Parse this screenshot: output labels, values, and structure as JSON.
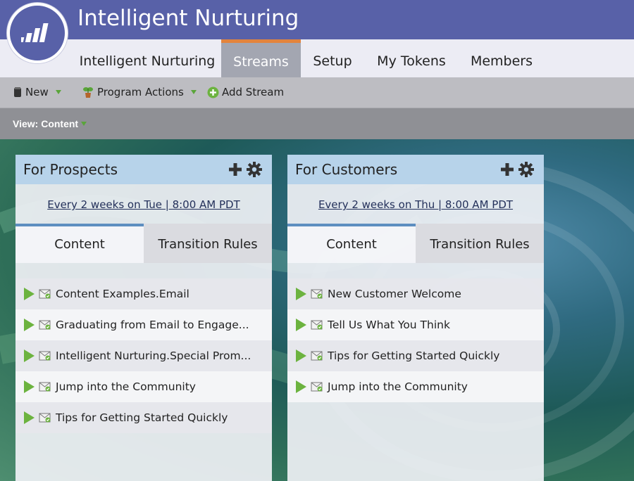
{
  "header": {
    "title": "Intelligent Nurturing"
  },
  "tabs": [
    {
      "label": "Intelligent Nurturing"
    },
    {
      "label": "Streams"
    },
    {
      "label": "Setup"
    },
    {
      "label": "My Tokens"
    },
    {
      "label": "Members"
    }
  ],
  "active_tab": "Streams",
  "toolbar": {
    "new_label": "New",
    "program_actions_label": "Program Actions",
    "add_stream_label": "Add Stream"
  },
  "view": {
    "label": "View: Content"
  },
  "colors": {
    "header": "#5861a8",
    "active_tab_accent": "#e3843d",
    "play": "#6cb33f",
    "card_header": "#b7d3ea"
  },
  "streams": [
    {
      "title": "For Prospects",
      "cadence": "Every 2 weeks on Tue | 8:00 AM PDT",
      "tab_content": "Content",
      "tab_rules": "Transition Rules",
      "items": [
        "Content Examples.Email",
        "Graduating from Email to Engage...",
        "Intelligent Nurturing.Special Prom...",
        "Jump into the Community",
        "Tips for Getting Started Quickly"
      ]
    },
    {
      "title": "For Customers",
      "cadence": "Every 2 weeks on Thu | 8:00 AM PDT",
      "tab_content": "Content",
      "tab_rules": "Transition Rules",
      "items": [
        "New Customer Welcome",
        "Tell Us What You Think",
        "Tips for Getting Started Quickly",
        "Jump into the Community"
      ]
    }
  ]
}
